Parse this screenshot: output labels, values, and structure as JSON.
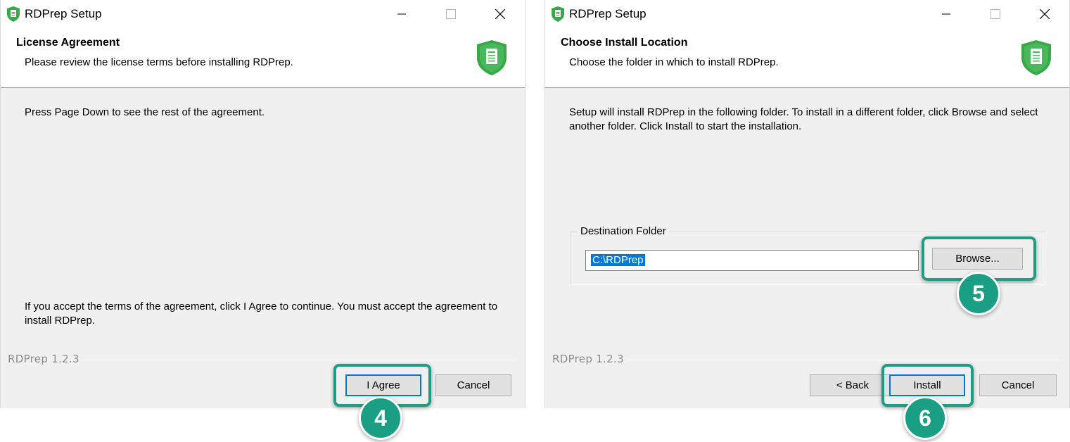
{
  "colors": {
    "accent_green": "#1a9e84",
    "focus_blue": "#0078d7",
    "dialog_bg": "#f0f0f0"
  },
  "left_window": {
    "title": "RDPrep Setup",
    "header": {
      "title": "License Agreement",
      "subtitle": "Please review the license terms before installing RDPrep."
    },
    "instruction": "Press Page Down to see the rest of the agreement.",
    "accept_text": "If you accept the terms of the agreement, click I Agree to continue. You must accept the agreement to install RDPrep.",
    "brand": "RDPrep 1.2.3",
    "buttons": {
      "agree": "I Agree",
      "cancel": "Cancel"
    },
    "step": "4"
  },
  "right_window": {
    "title": "RDPrep Setup",
    "header": {
      "title": "Choose Install Location",
      "subtitle": "Choose the folder in which to install RDPrep."
    },
    "instruction": "Setup will install RDPrep in the following folder. To install in a different folder, click Browse and select another folder. Click Install to start the installation.",
    "group_label": "Destination Folder",
    "folder_value": "C:\\RDPrep",
    "brand": "RDPrep 1.2.3",
    "buttons": {
      "browse": "Browse...",
      "back": "< Back",
      "install": "Install",
      "cancel": "Cancel"
    },
    "steps": {
      "browse": "5",
      "install": "6"
    }
  }
}
